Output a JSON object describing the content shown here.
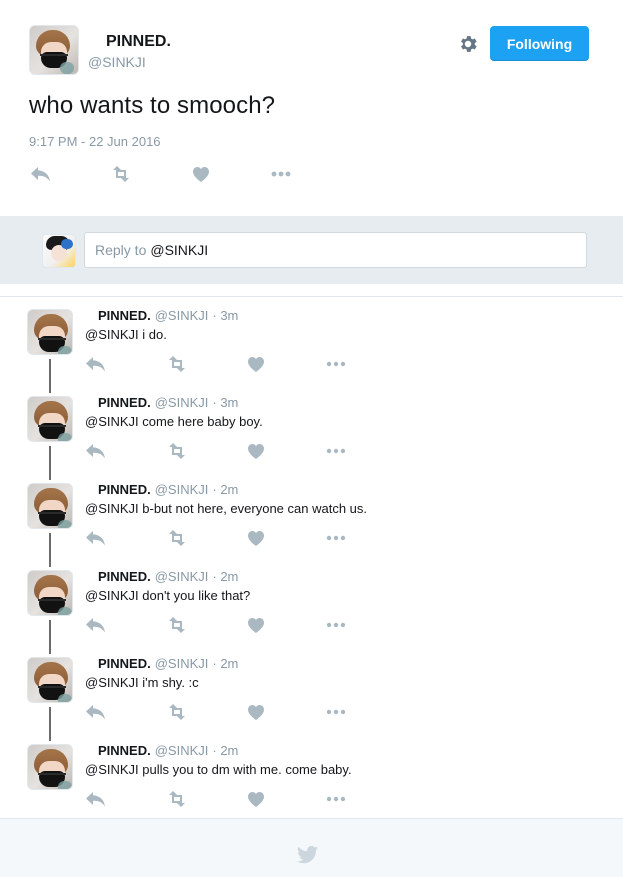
{
  "header": {
    "display_name": "PINNED.",
    "handle": "@SINKJI",
    "follow_label": "Following"
  },
  "main_tweet": {
    "text": "who wants to smooch?",
    "timestamp": "9:17 PM - 22 Jun 2016"
  },
  "reply_box": {
    "prefix": "Reply to",
    "mention": "@SINKJI"
  },
  "replies": [
    {
      "name": "PINNED.",
      "handle": "@SINKJI",
      "time": "· 3m",
      "text": "@SINKJI i do."
    },
    {
      "name": "PINNED.",
      "handle": "@SINKJI",
      "time": "· 3m",
      "text": "@SINKJI come here baby boy."
    },
    {
      "name": "PINNED.",
      "handle": "@SINKJI",
      "time": "· 2m",
      "text": "@SINKJI b-but not here, everyone can watch us."
    },
    {
      "name": "PINNED.",
      "handle": "@SINKJI",
      "time": "· 2m",
      "text": "@SINKJI don't you like that?"
    },
    {
      "name": "PINNED.",
      "handle": "@SINKJI",
      "time": "· 2m",
      "text": "@SINKJI i'm shy. :c"
    },
    {
      "name": "PINNED.",
      "handle": "@SINKJI",
      "time": "· 2m",
      "text": "@SINKJI pulls you to dm with me. come baby."
    }
  ],
  "icons": {
    "reply": "reply-icon",
    "retweet": "retweet-icon",
    "like": "heart-icon",
    "more": "more-icon",
    "settings": "gear-icon",
    "logo": "twitter-bird-icon"
  },
  "colors": {
    "accent": "#1da1f2",
    "muted_text": "#8899a6",
    "icon_gray": "#aab8c2",
    "reply_bar_bg": "#e6ecf0"
  }
}
